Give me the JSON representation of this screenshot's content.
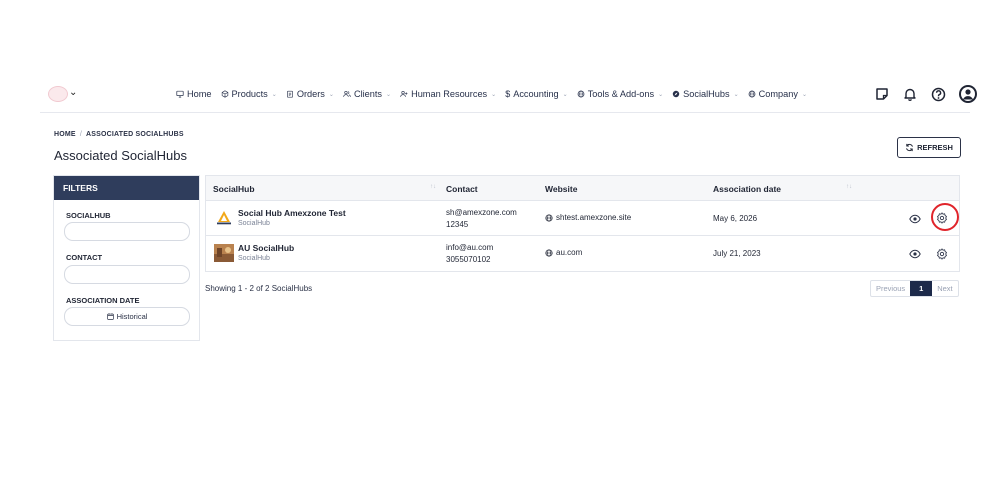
{
  "nav": {
    "items": [
      {
        "label": "Home",
        "icon": "monitor-icon",
        "dropdown": false
      },
      {
        "label": "Products",
        "icon": "cube-icon",
        "dropdown": true
      },
      {
        "label": "Orders",
        "icon": "clipboard-icon",
        "dropdown": true
      },
      {
        "label": "Clients",
        "icon": "users-icon",
        "dropdown": true
      },
      {
        "label": "Human Resources",
        "icon": "user-plus-icon",
        "dropdown": true
      },
      {
        "label": "Accounting",
        "icon": "dollar-icon",
        "dropdown": true
      },
      {
        "label": "Tools & Add-ons",
        "icon": "globe-icon",
        "dropdown": true
      },
      {
        "label": "SocialHubs",
        "icon": "compass-icon",
        "dropdown": true
      },
      {
        "label": "Company",
        "icon": "globe-icon",
        "dropdown": true
      }
    ],
    "actions": [
      "notes-icon",
      "bell-icon",
      "help-icon",
      "profile-icon"
    ]
  },
  "breadcrumb": {
    "home": "HOME",
    "sep": "/",
    "current": "ASSOCIATED SOCIALHUBS"
  },
  "page": {
    "title": "Associated SocialHubs",
    "refresh_label": "REFRESH"
  },
  "filters": {
    "title": "FILTERS",
    "socialhub_label": "SOCIALHUB",
    "socialhub_value": "",
    "contact_label": "CONTACT",
    "contact_value": "",
    "date_label": "ASSOCIATION DATE",
    "date_value": "Historical"
  },
  "table": {
    "columns": [
      "SocialHub",
      "Contact",
      "Website",
      "Association date"
    ],
    "rows": [
      {
        "name": "Social Hub Amexzone Test",
        "type": "SocialHub",
        "email": "sh@amexzone.com",
        "phone": "12345",
        "website": "shtest.amexzone.site",
        "date": "May 6, 2026"
      },
      {
        "name": "AU SocialHub",
        "type": "SocialHub",
        "email": "info@au.com",
        "phone": "3055070102",
        "website": "au.com",
        "date": "July 21, 2023"
      }
    ]
  },
  "footer": {
    "showing": "Showing 1 - 2 of 2 SocialHubs"
  },
  "pagination": {
    "previous": "Previous",
    "current": "1",
    "next": "Next"
  },
  "colors": {
    "header_bg": "#2f3d5c",
    "active_page": "#1d2a4a",
    "highlight": "#e0242b"
  }
}
